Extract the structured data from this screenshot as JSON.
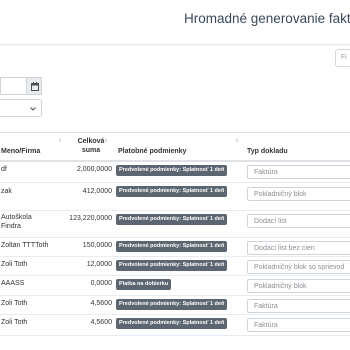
{
  "header": {
    "title": "Hromadné generovanie faktú"
  },
  "toolbar": {
    "right_field_placeholder": "Fi"
  },
  "table": {
    "columns": {
      "name": "Meno/Firma",
      "sum_line1": "Celková",
      "sum_line2": "suma",
      "terms": "Platobné podmienky",
      "type": "Typ dokladu"
    },
    "rows": [
      {
        "name": "df",
        "sum": "2,000,0000",
        "terms": "Predvolené podmienky: Splatnosť 1 deň",
        "type": "Faktúra"
      },
      {
        "name": "zak",
        "sum": "412,0000",
        "terms": "Predvolené podmienky: Splatnosť 1 deň",
        "type": "Pokladničný blok"
      },
      {
        "name_line1": "Autoškola",
        "name_line2": "Findra",
        "sum": "123,220,0000",
        "terms": "Predvolené podmienky: Splatnosť 1 deň",
        "type": "Dodací list"
      },
      {
        "name": "Zoltan TTTToth",
        "sum": "150,0000",
        "terms": "Predvolené podmienky: Splatnosť 1 deň",
        "type": "Dodací list bez cien"
      },
      {
        "name": "Zoli Toth",
        "sum": "12,0000",
        "terms": "Predvolené podmienky: Splatnosť 1 deň",
        "type": "Pokladničný blok so sprievod"
      },
      {
        "name": "AAASS",
        "sum": "0,0000",
        "terms": "Platba na dobierku",
        "type": "Pokladničný blok"
      },
      {
        "name": "Zoli Toth",
        "sum": "4,5600",
        "terms": "Predvolené podmienky: Splatnosť 1 deň",
        "type": "Faktúra"
      },
      {
        "name": "Zoli Toth",
        "sum": "4,5600",
        "terms": "Predvolené podmienky: Splatnosť 1 deň",
        "type": "Faktúra"
      }
    ]
  },
  "icons": {
    "calendar": "calendar-icon",
    "dropdown": "chevron-down-icon",
    "sort": "sort-icon"
  }
}
